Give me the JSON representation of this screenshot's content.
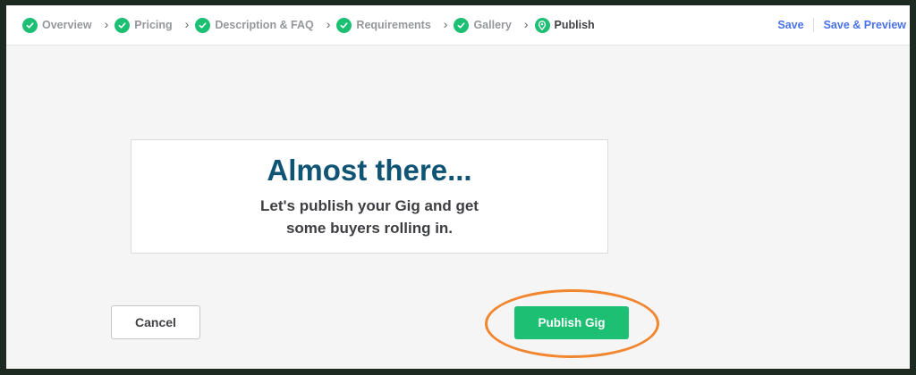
{
  "colors": {
    "accent_green": "#1dbf73",
    "title_blue": "#0f5474",
    "link_blue": "#4a73e8",
    "highlight_orange": "#f2862f"
  },
  "steps": [
    {
      "label": "Overview",
      "icon": "check-icon",
      "status": "done"
    },
    {
      "label": "Pricing",
      "icon": "check-icon",
      "status": "done"
    },
    {
      "label": "Description & FAQ",
      "icon": "check-icon",
      "status": "done"
    },
    {
      "label": "Requirements",
      "icon": "check-icon",
      "status": "done"
    },
    {
      "label": "Gallery",
      "icon": "check-icon",
      "status": "done"
    },
    {
      "label": "Publish",
      "icon": "location-pin-icon",
      "status": "current"
    }
  ],
  "nav": {
    "save_label": "Save",
    "save_preview_label": "Save & Preview"
  },
  "card": {
    "title": "Almost there...",
    "line1": "Let's publish your Gig and get",
    "line2": "some buyers rolling in."
  },
  "buttons": {
    "cancel_label": "Cancel",
    "publish_label": "Publish Gig"
  }
}
